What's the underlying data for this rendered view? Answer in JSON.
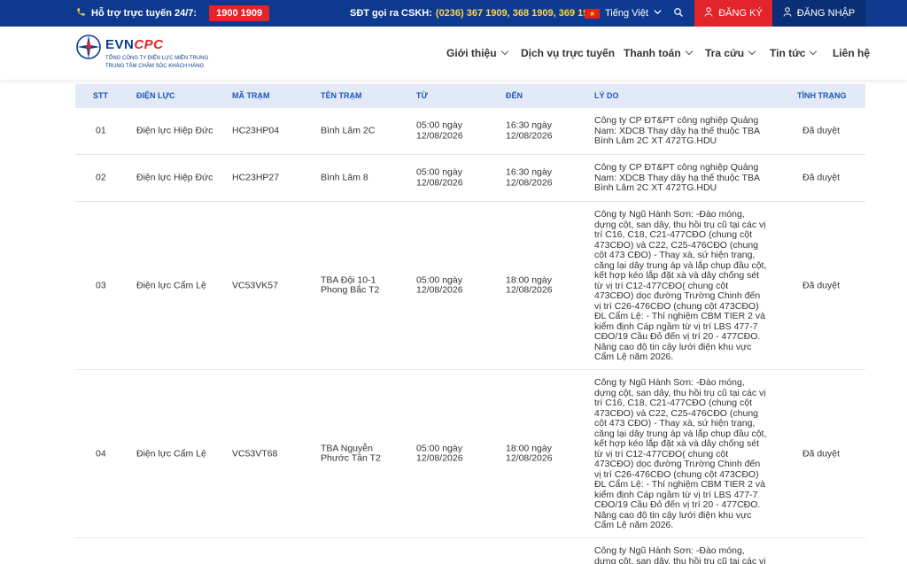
{
  "topbar": {
    "support_label": "Hỗ trợ trực tuyến 24/7:",
    "hotline": "1900 1909",
    "cskh_label": "SĐT gọi ra CSKH:",
    "cskh_phones": "(0236) 367 1909, 368 1909, 369 1909",
    "language": "Tiếng Việt",
    "register": "ĐĂNG KÝ",
    "login": "ĐĂNG NHẬP"
  },
  "logo": {
    "brand_a": "EVN",
    "brand_b": "CPC",
    "sub1": "TỔNG CÔNG TY ĐIỆN LỰC MIỀN TRUNG",
    "sub2": "TRUNG TÂM CHĂM SÓC KHÁCH HÀNG"
  },
  "nav": [
    "Giới thiệu",
    "Dịch vụ trực tuyến",
    "Thanh toán",
    "Tra cứu",
    "Tin tức",
    "Liên hệ"
  ],
  "table": {
    "headers": [
      "STT",
      "ĐIỆN LỰC",
      "MÃ TRẠM",
      "TÊN TRẠM",
      "TỪ",
      "ĐẾN",
      "LÝ DO",
      "TÌNH TRẠNG"
    ],
    "rows": [
      {
        "stt": "01",
        "dienluc": "Điện lực Hiệp Đức",
        "ma": "HC23HP04",
        "ten": "Bình Lâm 2C",
        "tu": "05:00 ngày 12/08/2026",
        "den": "16:30 ngày 12/08/2026",
        "lydo": "Công ty CP ĐT&PT công nghiệp Quảng Nam: XDCB Thay dây hạ thế thuộc TBA Bình Lâm 2C XT 472TG.HDU",
        "tinhtrang": "Đã duyệt"
      },
      {
        "stt": "02",
        "dienluc": "Điện lực Hiệp Đức",
        "ma": "HC23HP27",
        "ten": "Bình Lâm 8",
        "tu": "05:00 ngày 12/08/2026",
        "den": "16:30 ngày 12/08/2026",
        "lydo": "Công ty CP ĐT&PT công nghiệp Quảng Nam: XDCB Thay dây hạ thế thuộc TBA Bình Lâm 2C XT 472TG.HDU",
        "tinhtrang": "Đã duyệt"
      },
      {
        "stt": "03",
        "dienluc": "Điện lực Cẩm Lệ",
        "ma": "VC53VK57",
        "ten": "TBA Đội 10-1 Phong Bắc T2",
        "tu": "05:00 ngày 12/08/2026",
        "den": "18:00 ngày 12/08/2026",
        "lydo": "Công ty Ngũ Hành Sơn: -Đào móng, dựng cột, san dây, thu hồi trụ cũ tại các vị trí C16, C18, C21-477CĐO (chung cột 473CĐO) và C22, C25-476CĐO (chung cột 473 CĐO) - Thay xà, sứ hiện trạng, căng lại dây trung áp và lắp chụp đầu cột, kết hợp kéo lắp đặt xà và dây chống sét từ vị trí C12-477CĐO( chung cột 473CĐO) dọc đường Trường Chinh đến vị trí C26-476CĐO (chung cột 473CĐO) ĐL Cẩm Lệ: - Thí nghiệm CBM TIER 2 và kiểm định Cáp ngầm từ vị trí LBS 477-7 CĐO/19 Cầu Đỏ đến vị trí 20 - 477CĐO. Nâng cao độ tin cậy lưới điện khu vực Cẩm Lệ năm 2026.",
        "tinhtrang": "Đã duyệt"
      },
      {
        "stt": "04",
        "dienluc": "Điện lực Cẩm Lệ",
        "ma": "VC53VT68",
        "ten": "TBA Nguyễn Phước Tần T2",
        "tu": "05:00 ngày 12/08/2026",
        "den": "18:00 ngày 12/08/2026",
        "lydo": "Công ty Ngũ Hành Sơn: -Đào móng, dựng cột, san dây, thu hồi trụ cũ tại các vị trí C16, C18, C21-477CĐO (chung cột 473CĐO) và C22, C25-476CĐO (chung cột 473 CĐO) - Thay xà, sứ hiện trạng, căng lại dây trung áp và lắp chụp đầu cột, kết hợp kéo lắp đặt xà và dây chống sét từ vị trí C12-477CĐO( chung cột 473CĐO) dọc đường Trường Chinh đến vị trí C26-476CĐO (chung cột 473CĐO) ĐL Cẩm Lệ: - Thí nghiệm CBM TIER 2 và kiểm định Cáp ngầm từ vị trí LBS 477-7 CĐO/19 Cầu Đỏ đến vị trí 20 - 477CĐO. Nâng cao độ tin cậy lưới điện khu vực Cẩm Lệ năm 2026.",
        "tinhtrang": "Đã duyệt"
      },
      {
        "stt": "",
        "dienluc": "",
        "ma": "",
        "ten": "",
        "tu": "",
        "den": "",
        "lydo": "Công ty Ngũ Hành Sơn: -Đào móng, dựng cột, san dây, thu hồi trụ cũ tại các vị trí",
        "tinhtrang": ""
      }
    ]
  }
}
